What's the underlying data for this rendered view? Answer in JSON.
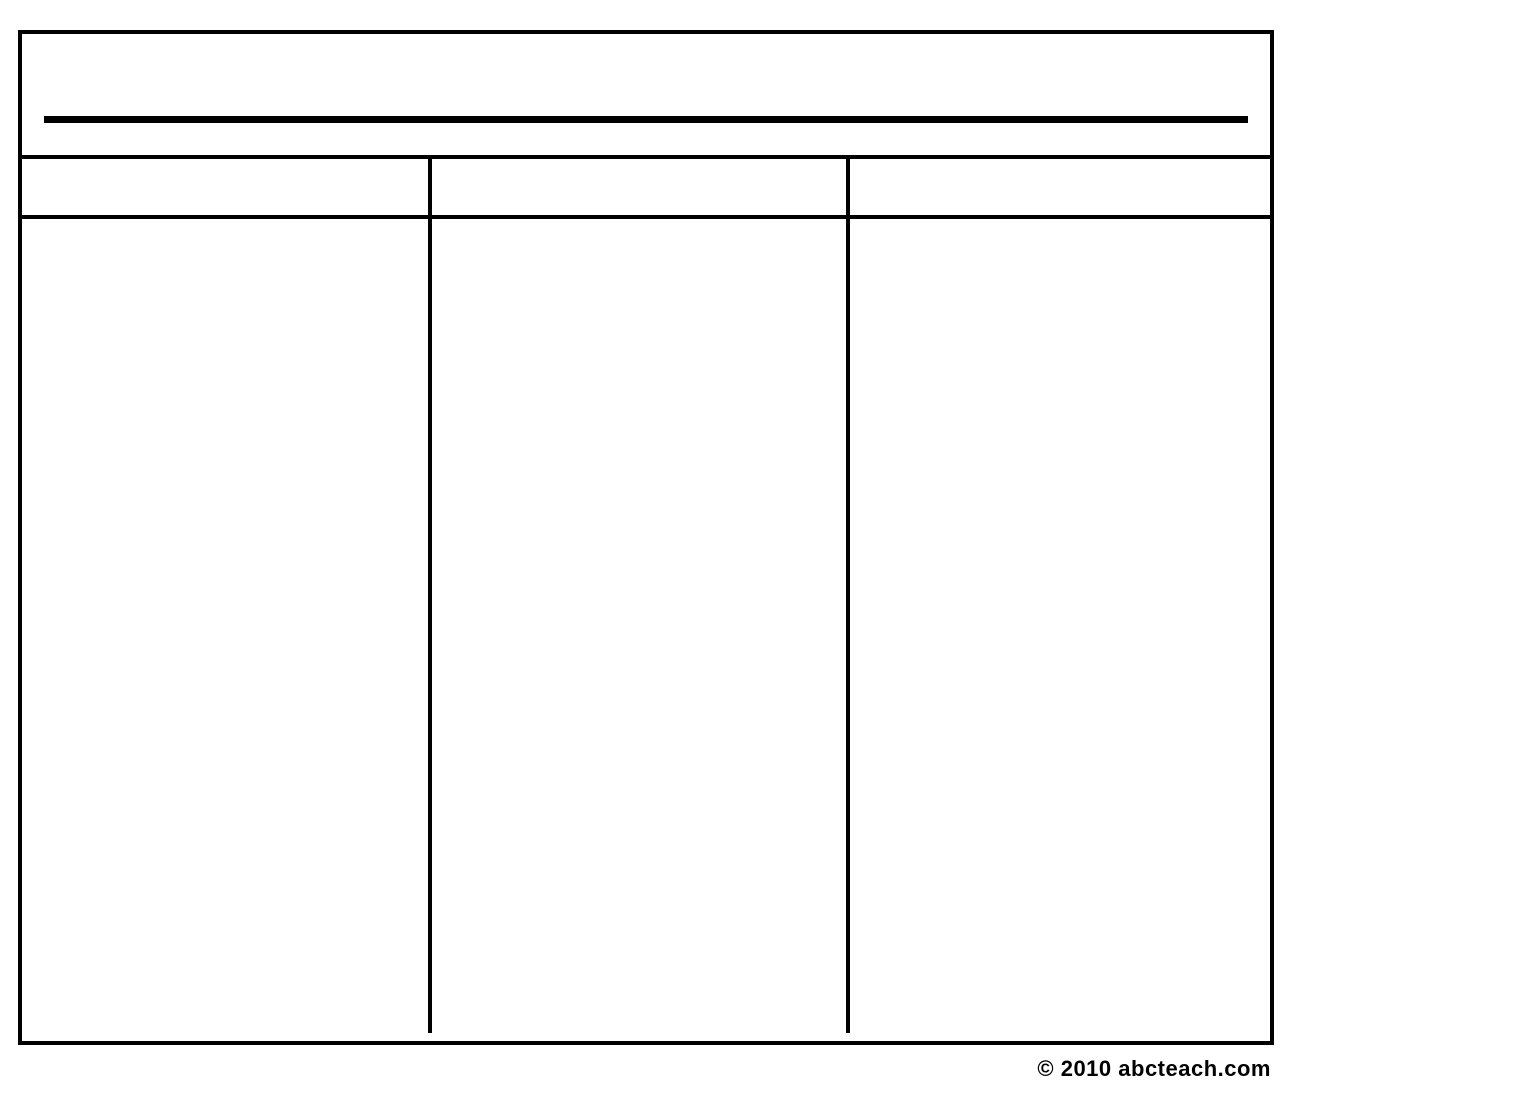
{
  "worksheet": {
    "title": "",
    "columns": {
      "header1": "",
      "header2": "",
      "header3": "",
      "body1": "",
      "body2": "",
      "body3": ""
    }
  },
  "footer": {
    "copyright": "© 2010 abcteach.com"
  }
}
